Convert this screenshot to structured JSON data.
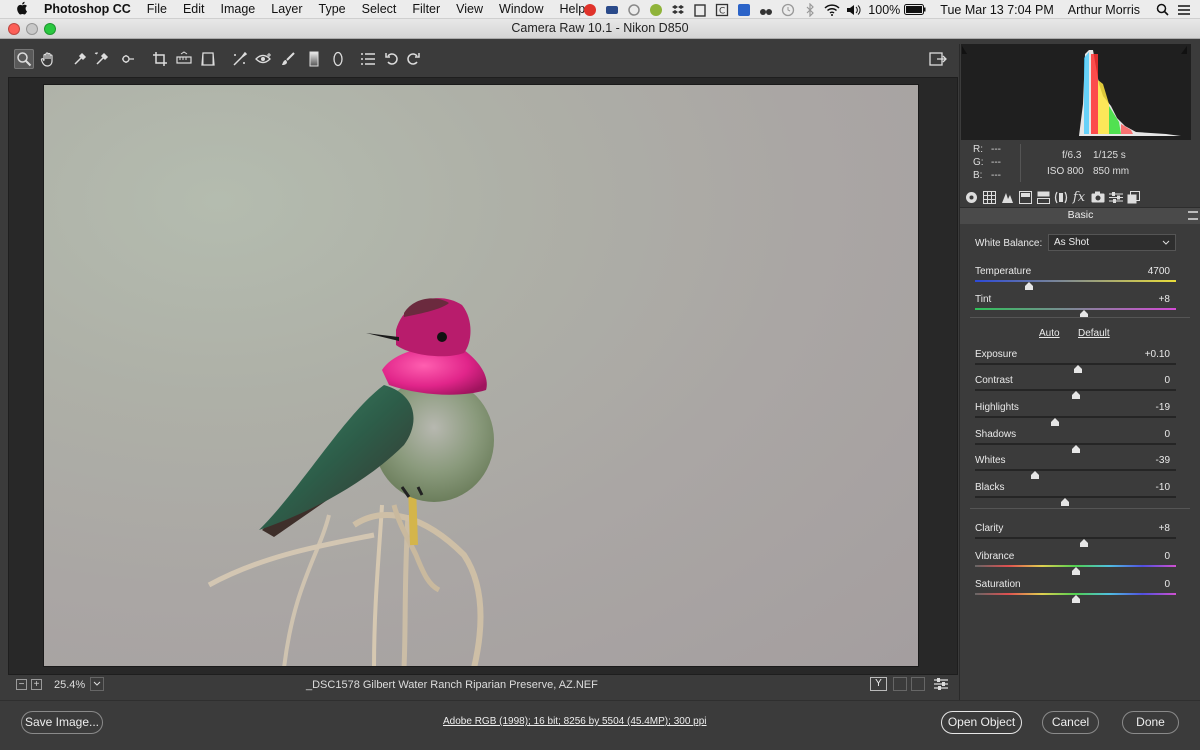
{
  "menubar": {
    "app_name": "Photoshop CC",
    "menus": [
      "File",
      "Edit",
      "Image",
      "Layer",
      "Type",
      "Select",
      "Filter",
      "View",
      "Window",
      "Help"
    ],
    "battery": "100%",
    "datetime": "Tue Mar 13  7:04 PM",
    "user": "Arthur Morris"
  },
  "window": {
    "title": "Camera Raw 10.1  -  Nikon D850"
  },
  "toolbar": {
    "tools": [
      "zoom-tool",
      "hand-tool",
      "white-balance-tool",
      "color-sampler-tool",
      "targeted-adjustment-tool",
      "crop-tool",
      "straighten-tool",
      "transform-tool",
      "spot-removal-tool",
      "red-eye-tool",
      "adjustment-brush-tool",
      "graduated-filter-tool",
      "radial-filter-tool",
      "preferences-tool",
      "rotate-ccw-tool",
      "rotate-cw-tool"
    ]
  },
  "status": {
    "zoom": "25.4%",
    "filename": "_DSC1578  Gilbert Water Ranch Riparian Preserve, AZ.NEF"
  },
  "bottom": {
    "save_label": "Save Image...",
    "workflow": "Adobe RGB (1998); 16 bit; 8256 by 5504 (45.4MP); 300 ppi",
    "open_label": "Open Object",
    "cancel_label": "Cancel",
    "done_label": "Done"
  },
  "readouts": {
    "r_label": "R:",
    "r_val": "---",
    "g_label": "G:",
    "g_val": "---",
    "b_label": "B:",
    "b_val": "---",
    "aperture": "f/6.3",
    "shutter": "1/125 s",
    "iso": "ISO 800",
    "focal": "850 mm"
  },
  "panel": {
    "title": "Basic",
    "wb_label": "White Balance:",
    "wb_value": "As Shot",
    "auto_label": "Auto",
    "default_label": "Default",
    "sliders": [
      {
        "label": "Temperature",
        "value": "4700",
        "level": 0.27
      },
      {
        "label": "Tint",
        "value": "+8",
        "level": 0.54
      },
      {
        "label": "Exposure",
        "value": "+0.10",
        "level": 0.51
      },
      {
        "label": "Contrast",
        "value": "0",
        "level": 0.5
      },
      {
        "label": "Highlights",
        "value": "-19",
        "level": 0.4
      },
      {
        "label": "Shadows",
        "value": "0",
        "level": 0.5
      },
      {
        "label": "Whites",
        "value": "-39",
        "level": 0.3
      },
      {
        "label": "Blacks",
        "value": "-10",
        "level": 0.45
      },
      {
        "label": "Clarity",
        "value": "+8",
        "level": 0.54
      },
      {
        "label": "Vibrance",
        "value": "0",
        "level": 0.5
      },
      {
        "label": "Saturation",
        "value": "0",
        "level": 0.5
      }
    ]
  },
  "colors": {
    "ui_bg": "#3b3b3b",
    "panel_header": "#4a4a4a",
    "menubar": "#ececec"
  }
}
